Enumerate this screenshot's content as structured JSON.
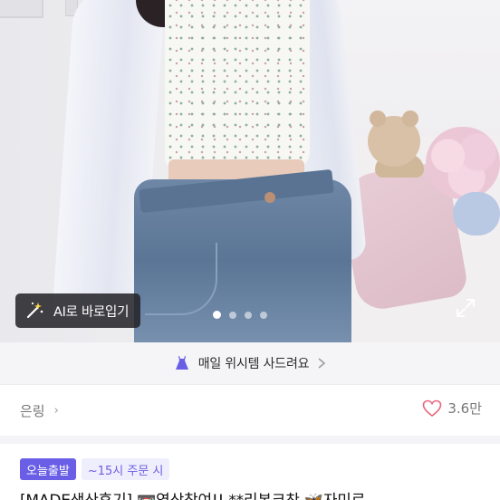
{
  "hero": {
    "ai_button_label": "AI로 바로입기",
    "ai_button_icon": "magic-wand-icon",
    "carousel": {
      "count": 4,
      "active_index": 0
    },
    "expand_icon": "expand-icon"
  },
  "banner": {
    "icon": "dress-icon",
    "text": "매일 위시템 사드려요",
    "chevron": "chevron-right-icon"
  },
  "shop": {
    "name": "은링",
    "chevron": "›",
    "likes": "3.6만",
    "heart_icon": "heart-icon"
  },
  "listing": {
    "badge_primary": "오늘출발",
    "badge_secondary": "~15시 주문 시",
    "title": "[MADE생산후기] 📼영상참여!! **리본크찬 🦋자미로"
  },
  "colors": {
    "accent": "#6a5ee6",
    "heart": "#e8667c",
    "banner_bg": "#f5f5f7"
  }
}
